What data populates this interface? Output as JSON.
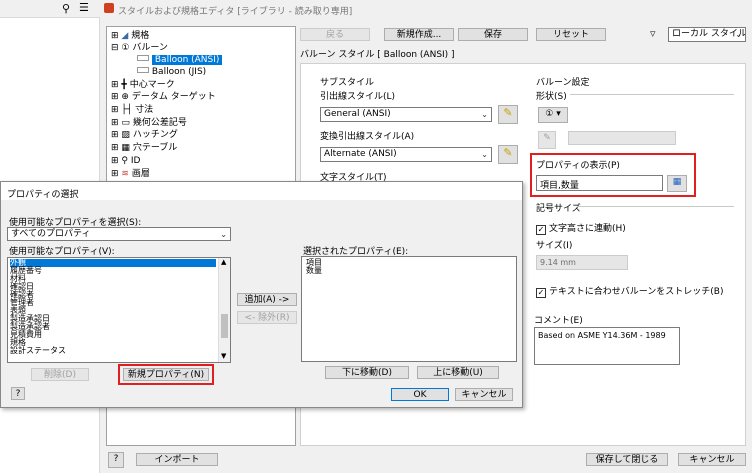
{
  "window_title": "スタイルおよび規格エディタ [ライブラリ - 読み取り専用]",
  "toolbar": {
    "back": "戻る",
    "new": "新規作成...",
    "save": "保存",
    "reset": "リセット",
    "filter_value": "ローカル スタイル"
  },
  "tree": {
    "items": [
      "規格",
      "バルーン",
      "Balloon (ANSI)",
      "Balloon (JIS)",
      "中心マーク",
      "データム ターゲット",
      "寸法",
      "幾何公差記号",
      "ハッチング",
      "穴テーブル",
      "ID",
      "画層"
    ]
  },
  "balloon": {
    "section_title": "バルーン スタイル [ Balloon (ANSI) ]",
    "sub_style": "サブスタイル",
    "leader_style_label": "引出線スタイル(L)",
    "leader_style_value": "General (ANSI)",
    "alt_leader_label": "変換引出線スタイル(A)",
    "alt_leader_value": "Alternate (ANSI)",
    "text_style_label": "文字スタイル(T)",
    "balloon_settings": "バルーン設定",
    "shape_label": "形状(S)",
    "shape_icon": "①",
    "prop_display_label": "プロパティの表示(P)",
    "prop_display_value": "項目,数量",
    "symbol_size": "記号サイズ",
    "text_height_check": "文字高さに連動(H)",
    "size_label": "サイズ(I)",
    "size_value": "9.14 mm",
    "stretch_check": "テキストに合わせバルーンをストレッチ(B)",
    "comment_label": "コメント(E)",
    "comment_value": "Based on ASME Y14.36M - 1989"
  },
  "bottom": {
    "import": "インポート",
    "save_close": "保存して閉じる",
    "cancel": "キャンセル"
  },
  "dialog": {
    "title": "プロパティの選択",
    "available_select_label": "使用可能なプロパティを選択(S):",
    "available_select_value": "すべてのプロパティ",
    "available_label": "使用可能なプロパティ(V):",
    "available_items": [
      "外観",
      "履歴番号",
      "材料",
      "確認日",
      "確認者",
      "管理者",
      "表題",
      "製造承認日",
      "製造承認者",
      "見積費用",
      "規格",
      "設計ステータス"
    ],
    "selected_label": "選択されたプロパティ(E):",
    "selected_items": [
      "項目",
      "数量"
    ],
    "add": "追加(A) ->",
    "remove": "<- 除外(R)",
    "delete": "削除(D)",
    "new_prop": "新規プロパティ(N)",
    "move_down": "下に移動(D)",
    "move_up": "上に移動(U)",
    "ok": "OK",
    "cancel": "キャンセル",
    "help": "?"
  },
  "colors": {
    "highlight": "#e0201e",
    "selection": "#0078d7"
  }
}
